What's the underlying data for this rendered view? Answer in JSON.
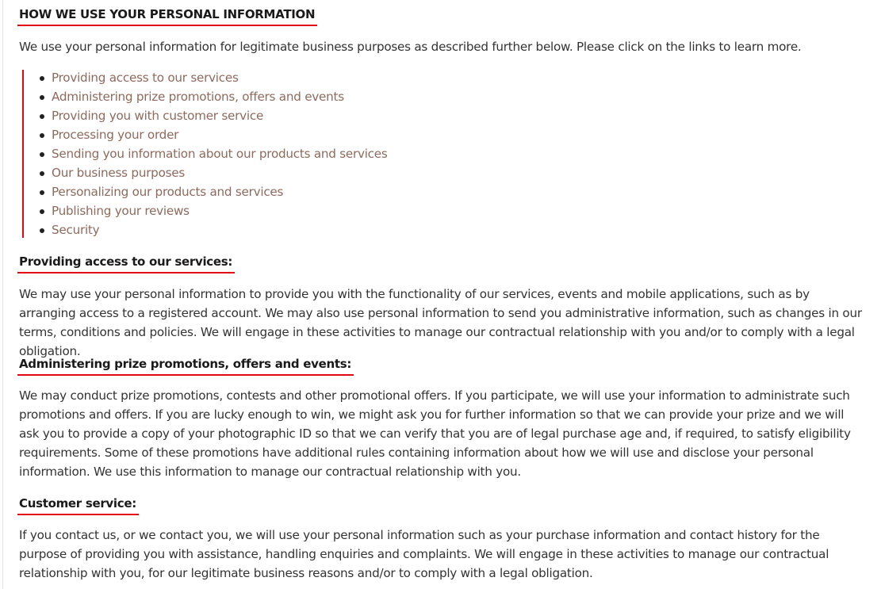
{
  "section": {
    "title": "HOW WE USE YOUR PERSONAL INFORMATION",
    "intro": "We use your personal information for legitimate business purposes as described further below. Please click on the links to learn more.",
    "links": [
      {
        "label": "Providing access to our services"
      },
      {
        "label": "Administering prize promotions, offers and events"
      },
      {
        "label": "Providing you with customer service"
      },
      {
        "label": "Processing your order"
      },
      {
        "label": "Sending you information about our products and services"
      },
      {
        "label": "Our business purposes"
      },
      {
        "label": "Personalizing our products and services"
      },
      {
        "label": "Publishing your reviews"
      },
      {
        "label": "Security"
      }
    ]
  },
  "subsections": [
    {
      "heading": "Providing access to our services:",
      "body": "We may use your personal information to provide you with the functionality of our services, events and mobile applications, such as by arranging access to a registered account. We may also use personal information to send you administrative information, such as changes in our terms, conditions and policies. We will engage in these activities to manage our contractual relationship with you and/or to comply with a legal obligation."
    },
    {
      "heading": "Administering prize promotions, offers and events:",
      "body": "We may conduct prize promotions, contests and other promotional offers. If you participate, we will use your information to administrate such promotions and offers. If you are lucky enough to win, we might ask you for further information so that we can provide your prize and we will ask you to provide a copy of your photographic ID so that we can verify that you are of legal purchase age and, if required, to satisfy eligibility requirements. Some of these promotions have additional rules containing information about how we will use and disclose your personal information. We use this information to manage our contractual relationship with you."
    },
    {
      "heading": "Customer service:",
      "body": "If you contact us, or we contact you, we will use your personal information such as your purchase information and contact history for the purpose of providing you with assistance, handling enquiries and complaints. We will engage in these activities to manage our contractual relationship with you, for our legitimate business reasons and/or to comply with a legal obligation."
    }
  ],
  "colors": {
    "accent": "#e30613",
    "link": "#8f6a5c",
    "text": "#333333",
    "heading": "#1a1a1a"
  }
}
